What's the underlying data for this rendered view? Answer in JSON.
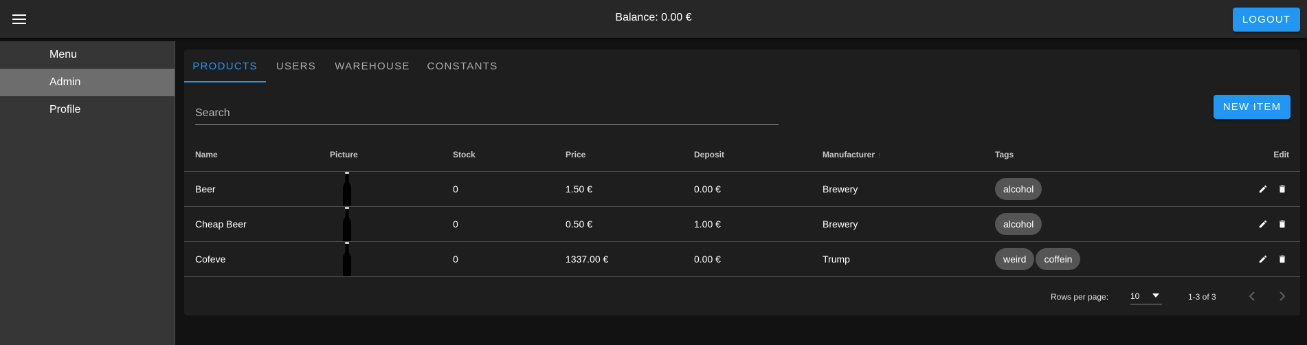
{
  "header": {
    "balance": "Balance: 0.00 €",
    "logout_label": "LOGOUT",
    "menu_icon": "hamburger-menu-icon"
  },
  "nav": {
    "items": [
      {
        "label": "Menu"
      },
      {
        "label": "Admin",
        "active": true
      },
      {
        "label": "Profile"
      }
    ]
  },
  "tabs": [
    {
      "label": "PRODUCTS",
      "active": true
    },
    {
      "label": "USERS"
    },
    {
      "label": "WAREHOUSE"
    },
    {
      "label": "CONSTANTS"
    }
  ],
  "search": {
    "placeholder": "Search",
    "value": ""
  },
  "new_item_label": "NEW ITEM",
  "table": {
    "headers": {
      "name": "Name",
      "picture": "Picture",
      "stock": "Stock",
      "price": "Price",
      "deposit": "Deposit",
      "manufacturer": "Manufacturer",
      "tags": "Tags",
      "edit": "Edit"
    },
    "sort_icon": "arrow-up-icon",
    "rows": [
      {
        "name": "Beer",
        "picture_icon": "bottle-icon",
        "stock": "0",
        "price": "1.50 €",
        "deposit": "0.00 €",
        "manufacturer": "Brewery",
        "tags": [
          "alcohol"
        ]
      },
      {
        "name": "Cheap Beer",
        "picture_icon": "bottle-icon",
        "stock": "0",
        "price": "0.50 €",
        "deposit": "1.00 €",
        "manufacturer": "Brewery",
        "tags": [
          "alcohol"
        ]
      },
      {
        "name": "Cofeve",
        "picture_icon": "bottle-icon",
        "stock": "0",
        "price": "1337.00 €",
        "deposit": "0.00 €",
        "manufacturer": "Trump",
        "tags": [
          "weird",
          "coffein"
        ]
      }
    ]
  },
  "footer": {
    "rows_per_page_label": "Rows per page:",
    "rows_per_page_value": "10",
    "range": "1-3 of 3"
  },
  "colors": {
    "accent": "#2196f3",
    "appbar": "#272727",
    "drawer": "#363636",
    "drawer_active": "#6d6d6d",
    "card": "#1e1e1e",
    "background": "#121212",
    "chip": "#555555"
  }
}
